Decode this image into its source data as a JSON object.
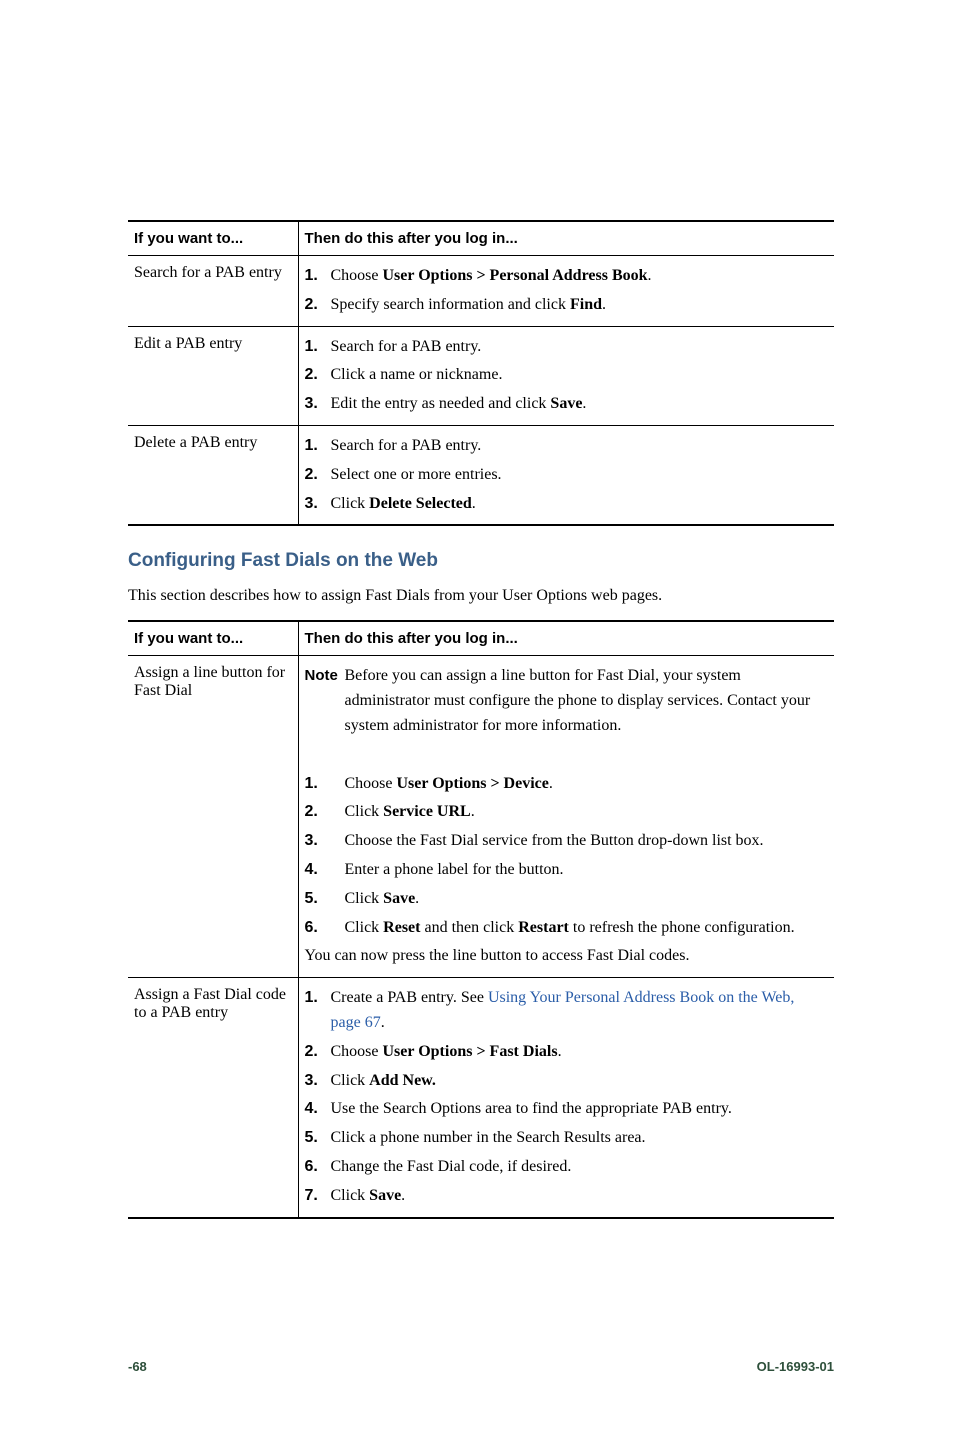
{
  "table1": {
    "headers": [
      "If you want to...",
      "Then do this after you log in..."
    ],
    "rows": [
      {
        "label": "Search for a PAB entry",
        "items": [
          {
            "num": "1.",
            "parts": [
              "Choose ",
              {
                "b": "User Options > Personal Address Book"
              },
              "."
            ]
          },
          {
            "num": "2.",
            "parts": [
              "Specify search information and click ",
              {
                "b": "Find"
              },
              "."
            ]
          }
        ]
      },
      {
        "label": "Edit a PAB entry",
        "items": [
          {
            "num": "1.",
            "parts": [
              "Search for a PAB entry."
            ]
          },
          {
            "num": "2.",
            "parts": [
              "Click a name or nickname."
            ]
          },
          {
            "num": "3.",
            "parts": [
              "Edit the entry as needed and click ",
              {
                "b": "Save"
              },
              "."
            ]
          }
        ]
      },
      {
        "label": "Delete a PAB entry",
        "items": [
          {
            "num": "1.",
            "parts": [
              "Search for a PAB entry."
            ]
          },
          {
            "num": "2.",
            "parts": [
              "Select one or more entries."
            ]
          },
          {
            "num": "3.",
            "parts": [
              "Click ",
              {
                "b": "Delete Selected"
              },
              "."
            ]
          }
        ]
      }
    ]
  },
  "section": {
    "heading": "Configuring Fast Dials on the Web",
    "intro": "This section describes how to assign Fast Dials from your User Options web pages."
  },
  "table2": {
    "headers": [
      "If you want to...",
      "Then do this after you log in..."
    ],
    "rows": [
      {
        "label": "Assign a line button for Fast Dial",
        "note": {
          "num": "Note",
          "parts": [
            "Before you can assign a line button for Fast Dial, your system administrator must configure the phone to display services. Contact your system administrator for more information."
          ]
        },
        "items": [
          {
            "num": "1.",
            "parts": [
              "Choose ",
              {
                "b": "User Options > Device"
              },
              "."
            ]
          },
          {
            "num": "2.",
            "parts": [
              "Click ",
              {
                "b": "Service URL"
              },
              "."
            ]
          },
          {
            "num": "3.",
            "parts": [
              "Choose the Fast Dial service from the Button drop-down list box."
            ]
          },
          {
            "num": "4.",
            "parts": [
              "Enter a phone label for the button."
            ]
          },
          {
            "num": "5.",
            "parts": [
              "Click ",
              {
                "b": "Save"
              },
              "."
            ]
          },
          {
            "num": "6.",
            "parts": [
              "Click ",
              {
                "b": "Reset"
              },
              " and then click ",
              {
                "b": "Restart"
              },
              " to refresh the phone configuration."
            ]
          }
        ],
        "after": "You can now press the line button to access Fast Dial codes."
      },
      {
        "label": "Assign a Fast Dial code to a PAB entry",
        "items": [
          {
            "num": "1.",
            "parts": [
              "Create a PAB entry. See ",
              {
                "link": "Using Your Personal Address Book on the Web, page 67"
              },
              "."
            ]
          },
          {
            "num": "2.",
            "parts": [
              "Choose ",
              {
                "b": "User Options > Fast Dials"
              },
              "."
            ]
          },
          {
            "num": "3.",
            "parts": [
              "Click ",
              {
                "b": "Add New."
              }
            ]
          },
          {
            "num": "4.",
            "parts": [
              "Use the Search Options area to find the appropriate PAB entry."
            ]
          },
          {
            "num": "5.",
            "parts": [
              "Click a phone number in the Search Results area."
            ]
          },
          {
            "num": "6.",
            "parts": [
              "Change the Fast Dial code, if desired."
            ]
          },
          {
            "num": "7.",
            "parts": [
              "Click ",
              {
                "b": "Save"
              },
              "."
            ]
          }
        ]
      }
    ]
  },
  "footer": {
    "left": "-68",
    "right": "OL-16993-01"
  }
}
